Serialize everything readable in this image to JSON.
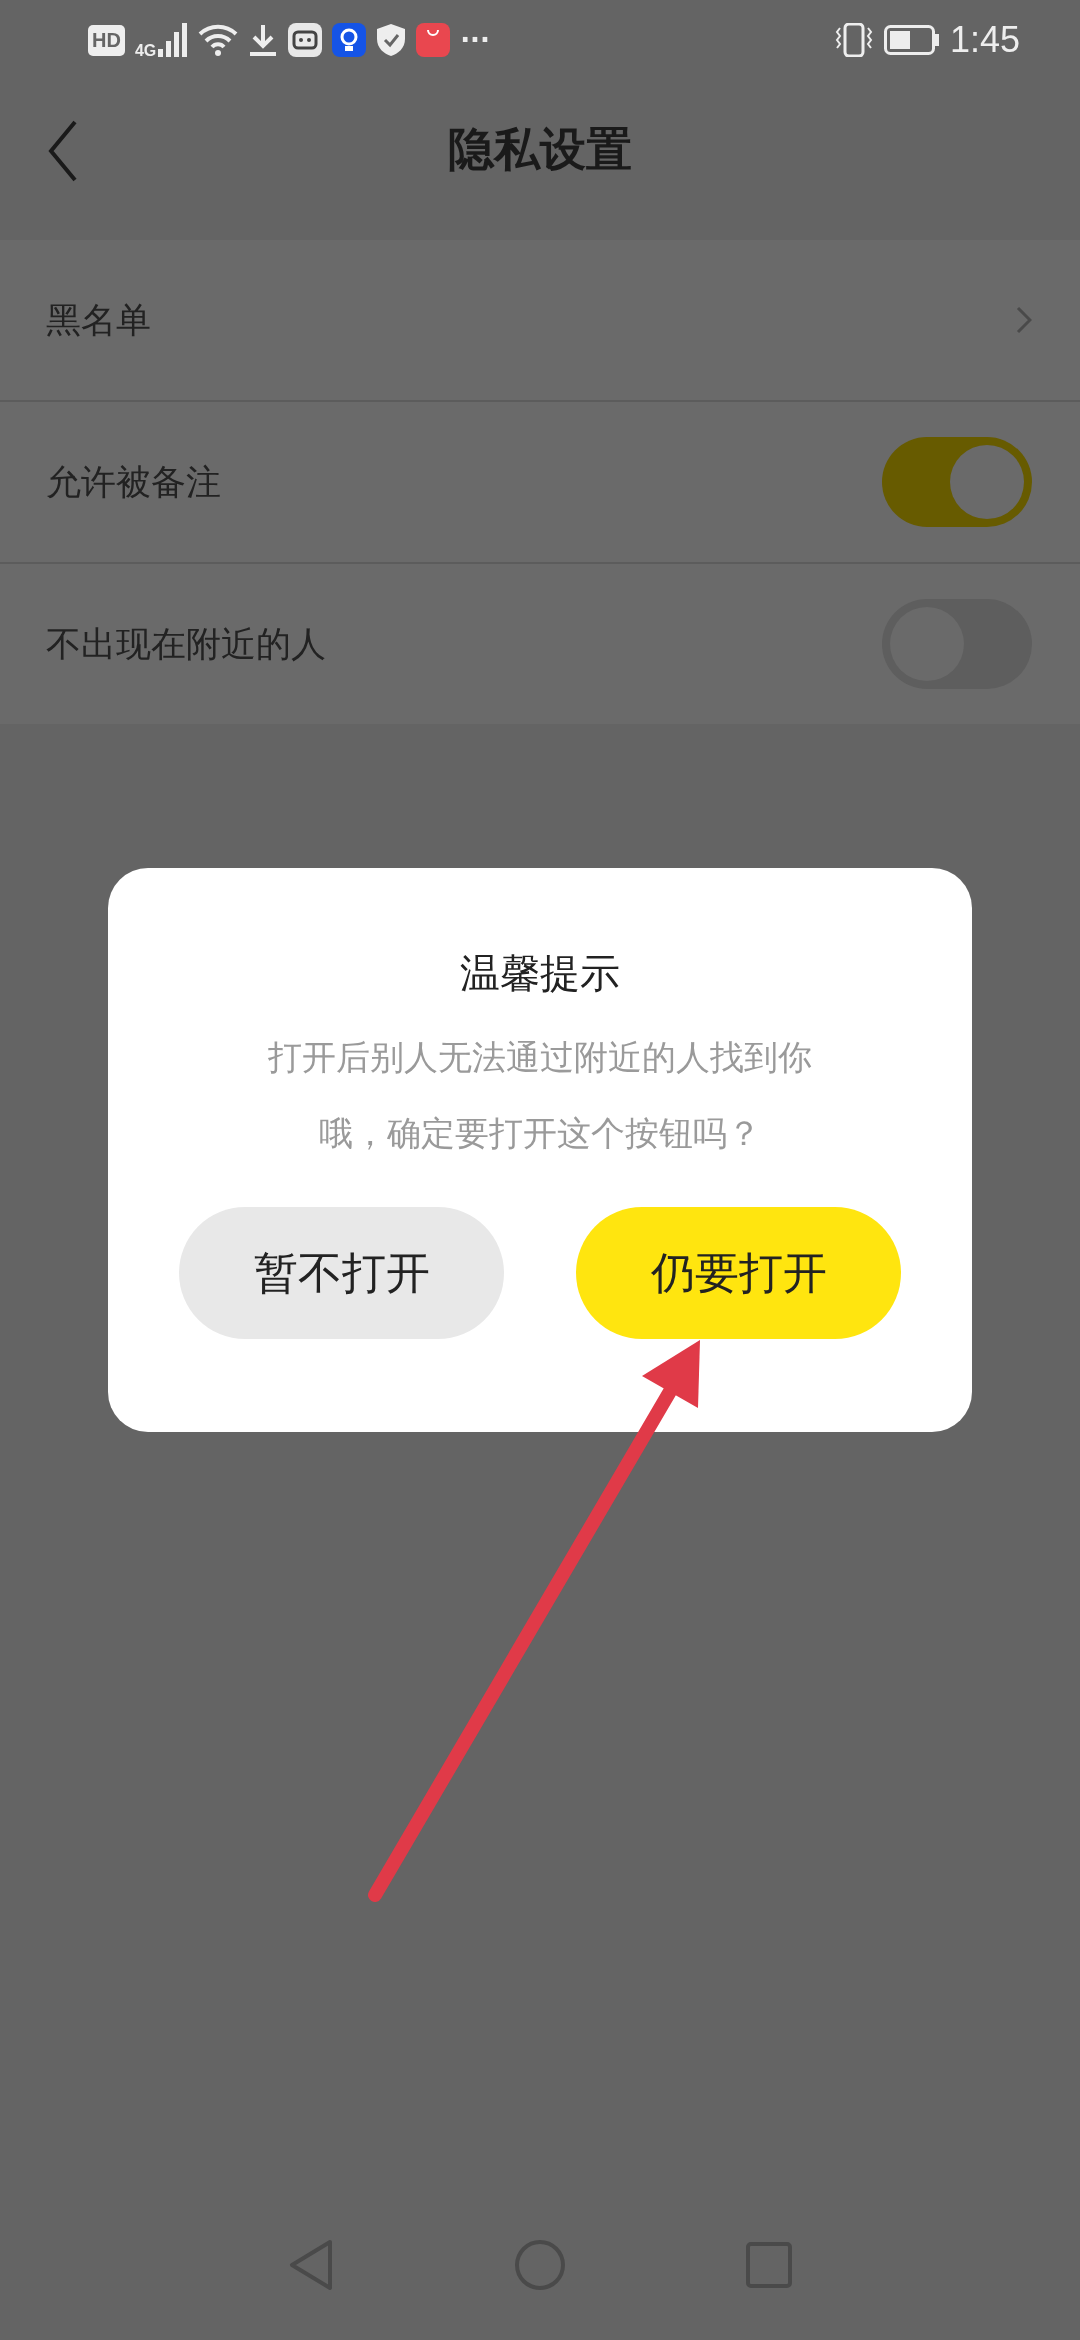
{
  "status_bar": {
    "network_badge": "HD",
    "network_type": "4G",
    "more": "···",
    "time": "1:45"
  },
  "header": {
    "title": "隐私设置"
  },
  "settings": [
    {
      "kind": "link",
      "label": "黑名单"
    },
    {
      "kind": "toggle",
      "label": "允许被备注",
      "on": true
    },
    {
      "kind": "toggle",
      "label": "不出现在附近的人",
      "on": false
    }
  ],
  "dialog": {
    "title": "温馨提示",
    "message_lines": [
      "打开后别人无法通过附近的人找到你",
      "哦，确定要打开这个按钮吗？"
    ],
    "buttons": [
      {
        "label": "暂不打开",
        "kind": "secondary"
      },
      {
        "label": "仍要打开",
        "kind": "primary"
      }
    ]
  }
}
